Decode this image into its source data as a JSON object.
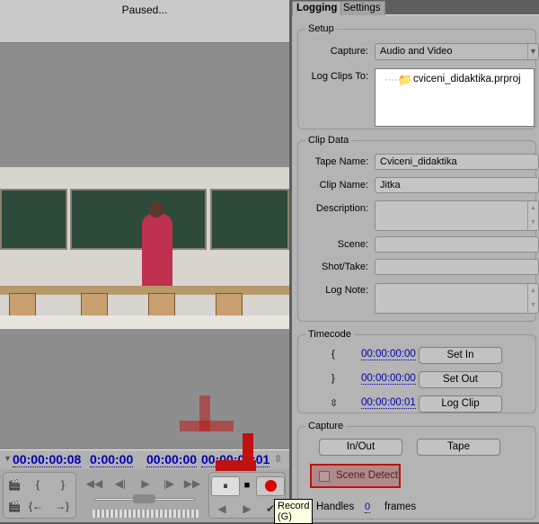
{
  "status": "Paused...",
  "timecodes": {
    "current": "00:00:00:08",
    "in": "0:00:00",
    "out": "00:00:00",
    "duration": "00:00:00:01"
  },
  "tooltip": "Record (G)",
  "tabs": [
    {
      "label": "Logging",
      "active": true
    },
    {
      "label": "Settings",
      "active": false
    }
  ],
  "setup": {
    "legend": "Setup",
    "capture_label": "Capture:",
    "capture_value": "Audio and Video",
    "log_label": "Log Clips To:",
    "project": "cviceni_didaktika.prproj"
  },
  "clip_data": {
    "legend": "Clip Data",
    "tape_label": "Tape Name:",
    "tape_value": "Cviceni_didaktika",
    "clip_label": "Clip Name:",
    "clip_value": "Jitka",
    "desc_label": "Description:",
    "desc_value": "",
    "scene_label": "Scene:",
    "scene_value": "",
    "shot_label": "Shot/Take:",
    "shot_value": "",
    "note_label": "Log Note:",
    "note_value": ""
  },
  "timecode": {
    "legend": "Timecode",
    "in": "00:00:00:00",
    "out": "00:00:00:00",
    "duration": "00:00:00:01",
    "set_in": "Set In",
    "set_out": "Set Out",
    "log_clip": "Log Clip"
  },
  "capture": {
    "legend": "Capture",
    "inout": "In/Out",
    "tape": "Tape",
    "scene_detect": "Scene Detect",
    "scene_detect_checked": false,
    "handles_label": "Handles",
    "handles_value": "0",
    "frames_label": "frames"
  },
  "colors": {
    "timecode": "#0000b0",
    "highlight": "#c01010",
    "record": "#e00000"
  }
}
